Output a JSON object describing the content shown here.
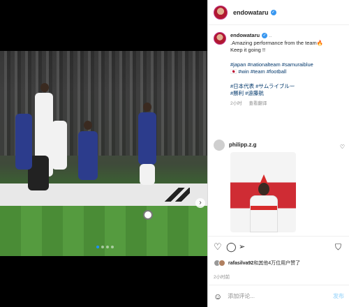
{
  "post": {
    "username": "endowataru",
    "caption": {
      "username": "endowataru",
      "lines": [
        ".Amazing performance from the team🔥",
        "Keep it going !!",
        "",
        "#japan #nationalteam #samuraiblue",
        "🇯🇵 #win #team #football",
        "",
        "#日本代表 #サムライブルー",
        "#勝利 #遠藤航"
      ],
      "time": "2小时",
      "see_translation": "查看翻译"
    },
    "comment": {
      "username": "philipp.z.g"
    },
    "likes_text_bold": "rafasilva92",
    "likes_text_rest": "和其他4万位用户赞了",
    "time_ago": "2小时前",
    "comment_placeholder": "添加评论...",
    "post_label": "发布"
  },
  "media": {
    "carousel_index": 1,
    "carousel_count": 4
  },
  "icons": {
    "like": "heart-icon",
    "comment": "comment-icon",
    "share": "share-icon",
    "save": "bookmark-icon",
    "emoji": "emoji-icon",
    "verified": "verified-badge-icon",
    "next": "chevron-right-icon"
  },
  "colors": {
    "accent": "#3897f0",
    "hashtag": "#00376b",
    "muted": "#8e8e8e"
  }
}
